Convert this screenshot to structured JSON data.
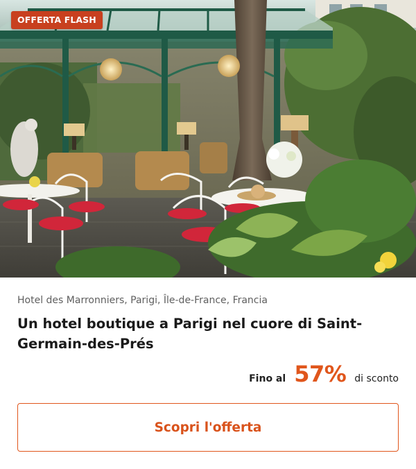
{
  "badge": {
    "label": "OFFERTA FLASH"
  },
  "hero": {
    "image_alt": "Giardino con gazebo in ferro battuto, tavoli e sedie bianche con cuscini rossi"
  },
  "hotel": {
    "location": "Hotel des Marronniers, Parigi, Île-de-France, Francia",
    "title": "Un hotel boutique a Parigi nel cuore di Saint-Germain-des-Prés"
  },
  "discount": {
    "prefix": "Fino al",
    "value": "57%",
    "suffix": "di sconto"
  },
  "cta": {
    "label": "Scopri l'offerta"
  },
  "colors": {
    "accent": "#e0561c",
    "badge_bg": "#c8401f",
    "text_primary": "#1a1a1a",
    "text_secondary": "#5f5f5f"
  }
}
